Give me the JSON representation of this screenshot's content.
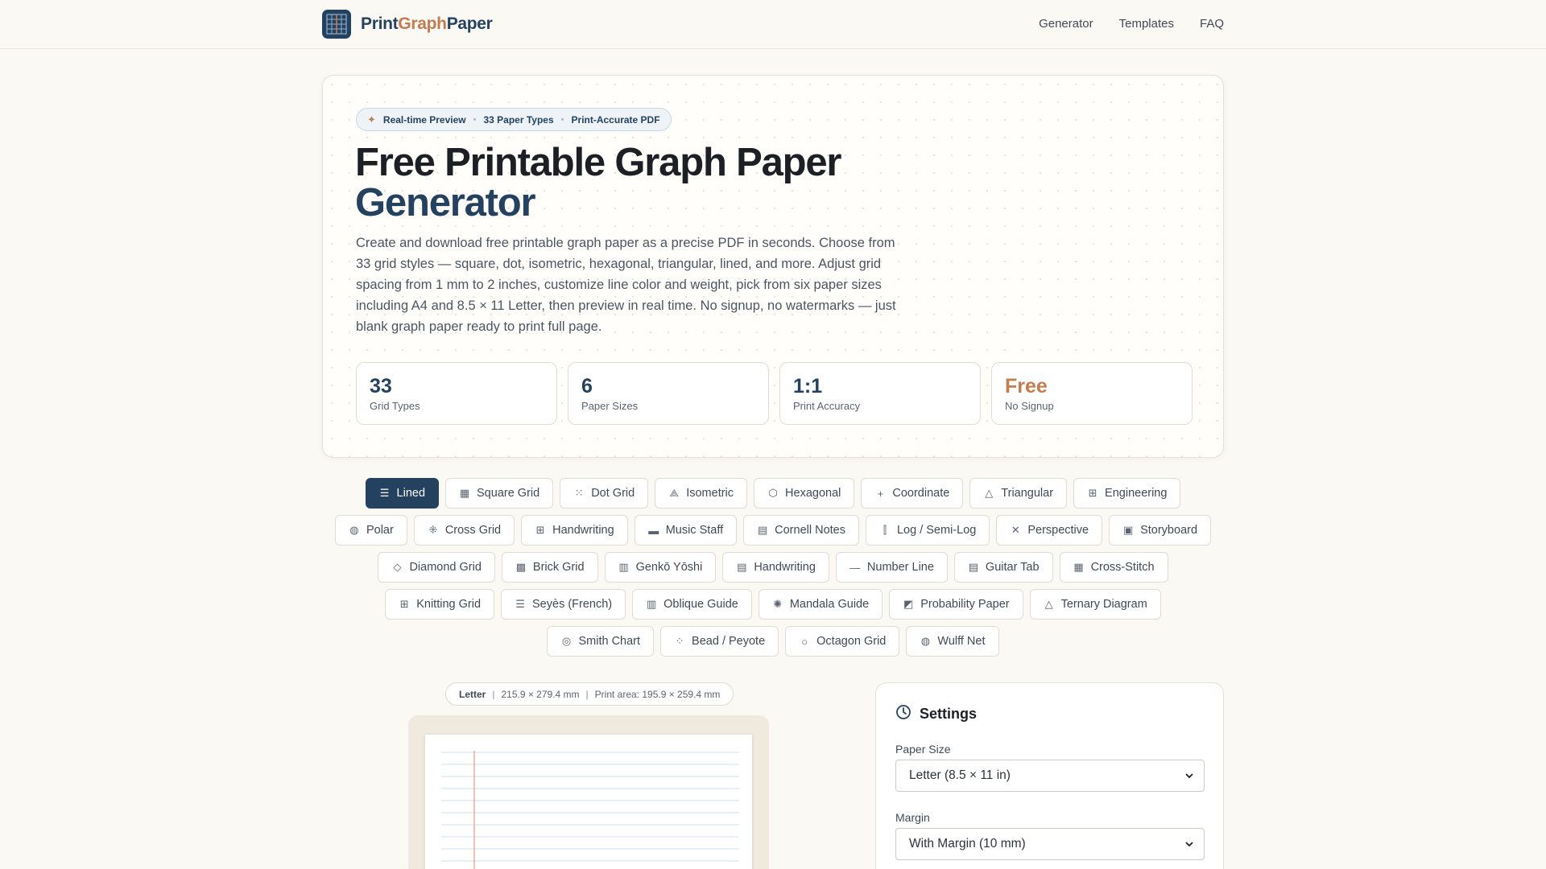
{
  "header": {
    "logo": {
      "part1": "Print",
      "part2": "Graph",
      "part3": "Paper"
    },
    "nav": [
      "Generator",
      "Templates",
      "FAQ"
    ]
  },
  "hero": {
    "pill": [
      "Real-time Preview",
      "33 Paper Types",
      "Print-Accurate PDF"
    ],
    "title_line1": "Free Printable Graph Paper",
    "title_line2": "Generator",
    "description": "Create and download free printable graph paper as a precise PDF in seconds. Choose from 33 grid styles — square, dot, isometric, hexagonal, triangular, lined, and more. Adjust grid spacing from 1 mm to 2 inches, customize line color and weight, pick from six paper sizes including A4 and 8.5 × 11 Letter, then preview in real time. No signup, no watermarks — just blank graph paper ready to print full page.",
    "stats": [
      {
        "value": "33",
        "label": "Grid Types"
      },
      {
        "value": "6",
        "label": "Paper Sizes"
      },
      {
        "value": "1:1",
        "label": "Print Accuracy"
      },
      {
        "value": "Free",
        "label": "No Signup"
      }
    ]
  },
  "paper_types": {
    "rows": [
      [
        {
          "label": "Lined",
          "icon": "lines-icon",
          "glyph": "☰",
          "active": true
        },
        {
          "label": "Square Grid",
          "icon": "grid-icon",
          "glyph": "▦",
          "active": false
        },
        {
          "label": "Dot Grid",
          "icon": "dots-icon",
          "glyph": "⁙",
          "active": false
        },
        {
          "label": "Isometric",
          "icon": "isometric-icon",
          "glyph": "⟁",
          "active": false
        },
        {
          "label": "Hexagonal",
          "icon": "hexagon-icon",
          "glyph": "⬡",
          "active": false
        },
        {
          "label": "Coordinate",
          "icon": "plus-icon",
          "glyph": "+",
          "active": false
        },
        {
          "label": "Triangular",
          "icon": "triangle-icon",
          "glyph": "△",
          "active": false
        },
        {
          "label": "Engineering",
          "icon": "grid-icon",
          "glyph": "⊞",
          "active": false
        }
      ],
      [
        {
          "label": "Polar",
          "icon": "polar-icon",
          "glyph": "◍",
          "active": false
        },
        {
          "label": "Cross Grid",
          "icon": "cross-icon",
          "glyph": "⁜",
          "active": false
        },
        {
          "label": "Handwriting",
          "icon": "grid-icon",
          "glyph": "⊞",
          "active": false
        },
        {
          "label": "Music Staff",
          "icon": "staff-icon",
          "glyph": "▬",
          "active": false
        },
        {
          "label": "Cornell Notes",
          "icon": "notes-icon",
          "glyph": "▤",
          "active": false
        },
        {
          "label": "Log / Semi-Log",
          "icon": "log-icon",
          "glyph": "⫿",
          "active": false
        },
        {
          "label": "Perspective",
          "icon": "perspective-icon",
          "glyph": "✕",
          "active": false
        },
        {
          "label": "Storyboard",
          "icon": "storyboard-icon",
          "glyph": "▣",
          "active": false
        }
      ],
      [
        {
          "label": "Diamond Grid",
          "icon": "diamond-icon",
          "glyph": "◇",
          "active": false
        },
        {
          "label": "Brick Grid",
          "icon": "brick-icon",
          "glyph": "▩",
          "active": false
        },
        {
          "label": "Genkō Yōshi",
          "icon": "genko-icon",
          "glyph": "▥",
          "active": false
        },
        {
          "label": "Handwriting",
          "icon": "handwriting-icon",
          "glyph": "▤",
          "active": false
        },
        {
          "label": "Number Line",
          "icon": "numberline-icon",
          "glyph": "—",
          "active": false
        },
        {
          "label": "Guitar Tab",
          "icon": "tab-icon",
          "glyph": "▤",
          "active": false
        },
        {
          "label": "Cross-Stitch",
          "icon": "stitch-icon",
          "glyph": "▦",
          "active": false
        }
      ],
      [
        {
          "label": "Knitting Grid",
          "icon": "knitting-icon",
          "glyph": "⊞",
          "active": false
        },
        {
          "label": "Seyès (French)",
          "icon": "seyes-icon",
          "glyph": "☰",
          "active": false
        },
        {
          "label": "Oblique Guide",
          "icon": "oblique-icon",
          "glyph": "▥",
          "active": false
        },
        {
          "label": "Mandala Guide",
          "icon": "mandala-icon",
          "glyph": "✺",
          "active": false
        },
        {
          "label": "Probability Paper",
          "icon": "probability-icon",
          "glyph": "◩",
          "active": false
        },
        {
          "label": "Ternary Diagram",
          "icon": "ternary-icon",
          "glyph": "△",
          "active": false
        }
      ],
      [
        {
          "label": "Smith Chart",
          "icon": "smith-icon",
          "glyph": "◎",
          "active": false
        },
        {
          "label": "Bead / Peyote",
          "icon": "bead-icon",
          "glyph": "⁘",
          "active": false
        },
        {
          "label": "Octagon Grid",
          "icon": "octagon-icon",
          "glyph": "○",
          "active": false
        },
        {
          "label": "Wulff Net",
          "icon": "globe-icon",
          "glyph": "◍",
          "active": false
        }
      ]
    ]
  },
  "preview": {
    "paper_name": "Letter",
    "dimensions": "215.9 × 279.4 mm",
    "print_area": "Print area: 195.9 × 259.4 mm"
  },
  "settings": {
    "title": "Settings",
    "paper_size_label": "Paper Size",
    "paper_size_value": "Letter (8.5 × 11 in)",
    "margin_label": "Margin",
    "margin_value": "With Margin (10 mm)"
  },
  "colors": {
    "primary": "#24425f",
    "accent": "#c37c4f",
    "background": "#fbf9f4",
    "ruled_line": "#cfe0ee",
    "margin_line": "#e59a8a"
  }
}
